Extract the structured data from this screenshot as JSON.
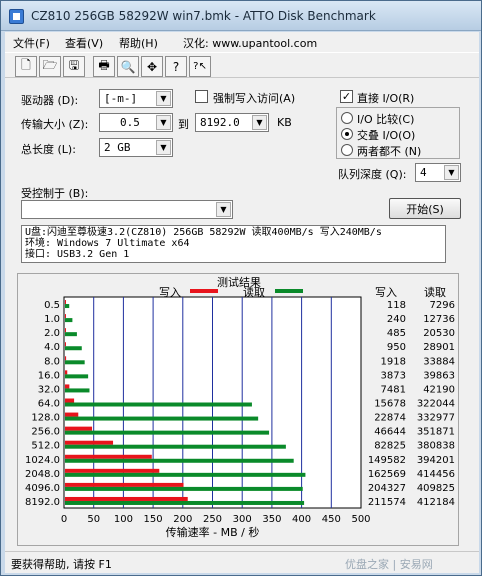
{
  "window": {
    "title": "CZ810 256GB 58292W win7.bmk - ATTO Disk Benchmark"
  },
  "menu": [
    "文件(F)",
    "查看(V)",
    "帮助(H)",
    "汉化: www.upantool.com"
  ],
  "toolbar": {
    "icons": [
      "new-file-icon",
      "open-folder-icon",
      "save-icon",
      "print-icon",
      "print-preview-icon",
      "move-icon",
      "help-icon",
      "context-help-icon"
    ],
    "glyphs": [
      "🗋",
      "🗁",
      "🖫",
      "🖶",
      "🔍",
      "✥",
      "?",
      "?↖"
    ]
  },
  "form": {
    "drive_label": "驱动器 (D):",
    "drive_value": "[-m-]",
    "force_write_label": "强制写入访问(A)",
    "direct_io_label": "直接 I/O(R)",
    "transfer_label": "传输大小 (Z):",
    "transfer_from": "0.5",
    "to_label": "到",
    "transfer_to": "8192.0",
    "kb_label": "KB",
    "io_compare_label": "I/O 比较(C)",
    "overlapped_label": "交叠 I/O(O)",
    "neither_label": "两者都不 (N)",
    "length_label": "总长度 (L):",
    "length_value": "2 GB",
    "queue_label": "队列深度 (Q):",
    "queue_value": "4",
    "controlled_label": "受控制于 (B):",
    "controlled_value": "",
    "start_label": "开始(S)"
  },
  "description": [
    "U盘:闪迪至尊极速3.2(CZ810) 256GB 58292W 读取400MB/s 写入240MB/s",
    "环境: Windows 7 Ultimate x64",
    "接口: USB3.2 Gen 1"
  ],
  "chart_data": {
    "type": "bar",
    "title": "测试结果",
    "xlabel": "传输速率 - MB / 秒",
    "xlim": [
      0,
      500
    ],
    "xticks": [
      0,
      50,
      100,
      150,
      200,
      250,
      300,
      350,
      400,
      450,
      500
    ],
    "categories": [
      "0.5",
      "1.0",
      "2.0",
      "4.0",
      "8.0",
      "16.0",
      "32.0",
      "64.0",
      "128.0",
      "256.0",
      "512.0",
      "1024.0",
      "2048.0",
      "4096.0",
      "8192.0"
    ],
    "series": [
      {
        "name": "写入",
        "color": "#e8141c",
        "values": [
          0.12,
          0.23,
          0.47,
          0.93,
          1.87,
          3.78,
          7.31,
          15.31,
          22.34,
          45.55,
          80.89,
          146.07,
          158.76,
          199.54,
          206.62
        ]
      },
      {
        "name": "读取",
        "color": "#0a8a2a",
        "values": [
          7.12,
          12.44,
          20.05,
          28.23,
          33.09,
          38.93,
          41.2,
          314.69,
          325.17,
          343.53,
          371.85,
          385.0,
          404.73,
          400.22,
          402.51
        ]
      }
    ],
    "table_headers": [
      "写入",
      "读取"
    ],
    "write_kb": [
      "118",
      "240",
      "485",
      "950",
      "1918",
      "3873",
      "7481",
      "15678",
      "22874",
      "46644",
      "82825",
      "149582",
      "162569",
      "204327",
      "211574"
    ],
    "read_kb": [
      "7296",
      "12736",
      "20530",
      "28901",
      "33884",
      "39863",
      "42190",
      "322044",
      "332977",
      "351871",
      "380838",
      "394201",
      "414456",
      "409825",
      "412184"
    ]
  },
  "status": {
    "text": "要获得帮助, 请按 F1",
    "watermark": "优盘之家 | 安易网"
  }
}
